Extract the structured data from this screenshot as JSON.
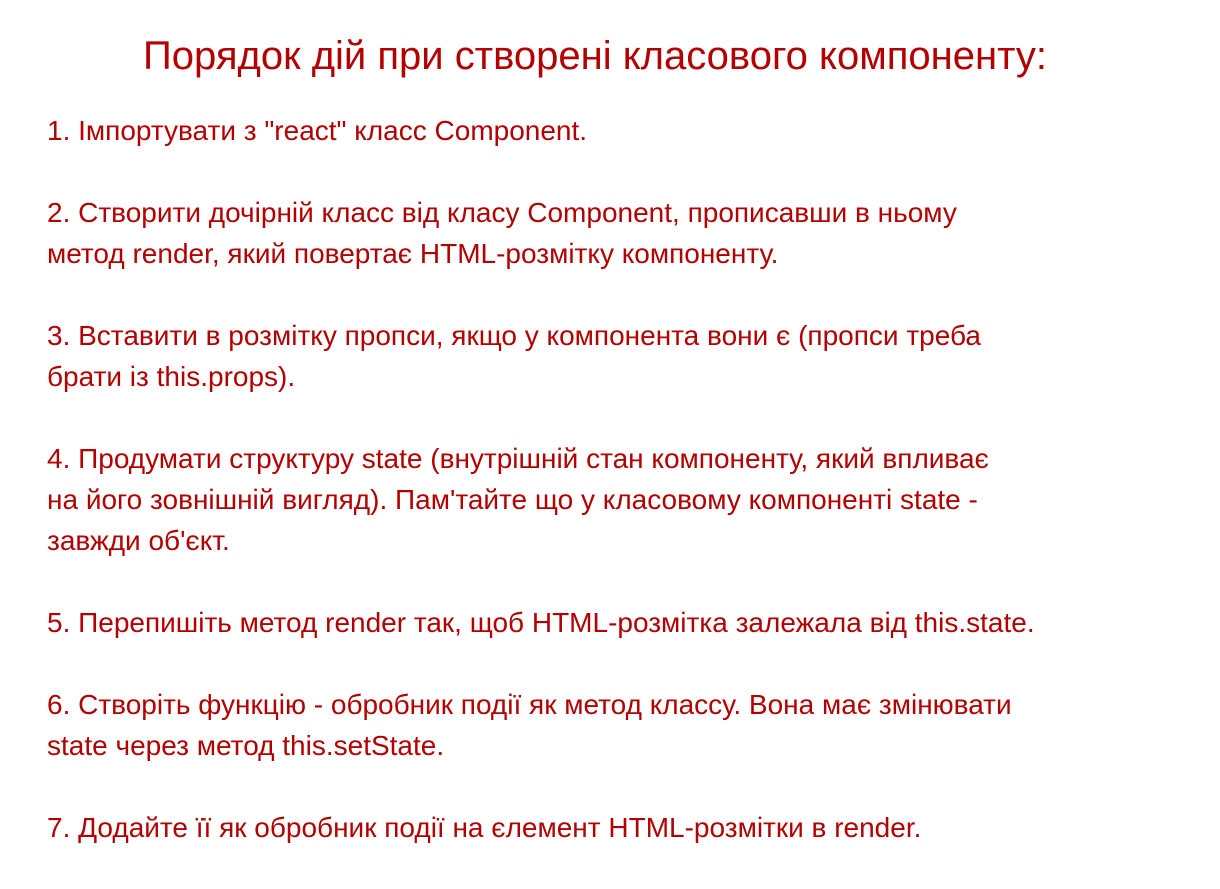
{
  "title": "Порядок дій при створені класового компоненту:",
  "steps": [
    {
      "lines": [
        "1. Імпортувати з \"react\" класс Component."
      ]
    },
    {
      "lines": [
        "2. Створити дочірній класс від класу Component, прописавши в ньому",
        "метод render, який повертає HTML-розмітку компоненту."
      ]
    },
    {
      "lines": [
        "3. Вставити в розмітку пропси, якщо у компонента вони є (пропси треба",
        "брати із this.props)."
      ]
    },
    {
      "lines": [
        "4. Продумати структуру state (внутрішній стан компоненту, який впливає",
        "на його зовнішній вигляд). Пам'тайте що у класовому компоненті state -",
        "завжди об'єкт."
      ]
    },
    {
      "lines": [
        "5. Перепишіть метод render так, щоб HTML-розмітка залежала від this.state."
      ]
    },
    {
      "lines": [
        "6. Створіть функцію - обробник події як метод классу. Вона має змінювати",
        "state через метод this.setState."
      ]
    },
    {
      "lines": [
        "7. Додайте її як обробник події на єлемент HTML-розмітки в render."
      ]
    }
  ]
}
